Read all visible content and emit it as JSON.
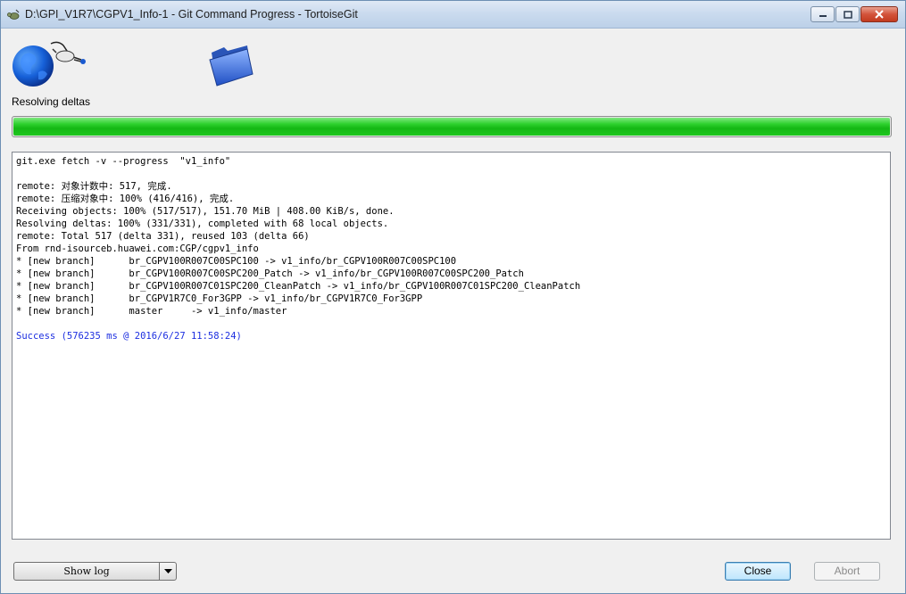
{
  "window": {
    "title": "D:\\GPI_V1R7\\CGPV1_Info-1 - Git Command Progress - TortoiseGit"
  },
  "icons": {
    "title_icon": "tortoisegit-icon",
    "operation_icon": "globe-network-icon",
    "target_icon": "folder-icon"
  },
  "status": {
    "label": "Resolving deltas",
    "progress": 1.0
  },
  "log": {
    "lines": [
      "git.exe fetch -v --progress  \"v1_info\"",
      "",
      "remote: 对象计数中: 517, 完成.",
      "remote: 压缩对象中: 100% (416/416), 完成.",
      "Receiving objects: 100% (517/517), 151.70 MiB | 408.00 KiB/s, done.",
      "Resolving deltas: 100% (331/331), completed with 68 local objects.",
      "remote: Total 517 (delta 331), reused 103 (delta 66)",
      "From rnd-isourceb.huawei.com:CGP/cgpv1_info",
      "* [new branch]      br_CGPV100R007C00SPC100 -> v1_info/br_CGPV100R007C00SPC100",
      "* [new branch]      br_CGPV100R007C00SPC200_Patch -> v1_info/br_CGPV100R007C00SPC200_Patch",
      "* [new branch]      br_CGPV100R007C01SPC200_CleanPatch -> v1_info/br_CGPV100R007C01SPC200_CleanPatch",
      "* [new branch]      br_CGPV1R7C0_For3GPP -> v1_info/br_CGPV1R7C0_For3GPP",
      "* [new branch]      master     -> v1_info/master",
      ""
    ],
    "success_line": "Success (576235 ms @ 2016/6/27 11:58:24)"
  },
  "buttons": {
    "show_log": "Show log",
    "close": "Close",
    "abort": "Abort"
  },
  "colors": {
    "progress": "#14b814",
    "success_text": "#1c2ee0"
  }
}
